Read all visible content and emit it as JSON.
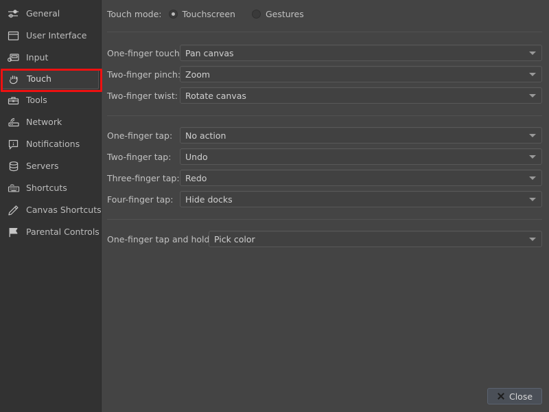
{
  "sidebar": {
    "items": [
      {
        "label": "General",
        "icon": "sliders-icon",
        "selected": false
      },
      {
        "label": "User Interface",
        "icon": "window-icon",
        "selected": false
      },
      {
        "label": "Input",
        "icon": "tablet-input-icon",
        "selected": false
      },
      {
        "label": "Touch",
        "icon": "hand-icon",
        "selected": true
      },
      {
        "label": "Tools",
        "icon": "toolbox-icon",
        "selected": false
      },
      {
        "label": "Network",
        "icon": "network-icon",
        "selected": false
      },
      {
        "label": "Notifications",
        "icon": "notification-icon",
        "selected": false
      },
      {
        "label": "Servers",
        "icon": "database-icon",
        "selected": false
      },
      {
        "label": "Shortcuts",
        "icon": "keyboard-icon",
        "selected": false
      },
      {
        "label": "Canvas Shortcuts",
        "icon": "pencil-icon",
        "selected": false
      },
      {
        "label": "Parental Controls",
        "icon": "flag-icon",
        "selected": false
      }
    ],
    "highlight_color": "#ee1111"
  },
  "main": {
    "touch_mode": {
      "label": "Touch mode:",
      "options": [
        {
          "label": "Touchscreen",
          "selected": true
        },
        {
          "label": "Gestures",
          "selected": false
        }
      ]
    },
    "group_gestures": [
      {
        "label": "One-finger touch:",
        "value": "Pan canvas"
      },
      {
        "label": "Two-finger pinch:",
        "value": "Zoom"
      },
      {
        "label": "Two-finger twist:",
        "value": "Rotate canvas"
      }
    ],
    "group_taps": [
      {
        "label": "One-finger tap:",
        "value": "No action"
      },
      {
        "label": "Two-finger tap:",
        "value": "Undo"
      },
      {
        "label": "Three-finger tap:",
        "value": "Redo"
      },
      {
        "label": "Four-finger tap:",
        "value": "Hide docks"
      }
    ],
    "group_hold": [
      {
        "label": "One-finger tap and hold:",
        "value": "Pick color"
      }
    ]
  },
  "footer": {
    "close_label": "Close"
  },
  "colors": {
    "background": "#444444",
    "sidebar": "#323232",
    "text": "#c2c2c2",
    "combo_bg": "#414141",
    "accent_button": "#4a4f57",
    "annotation": "#ee1111"
  }
}
